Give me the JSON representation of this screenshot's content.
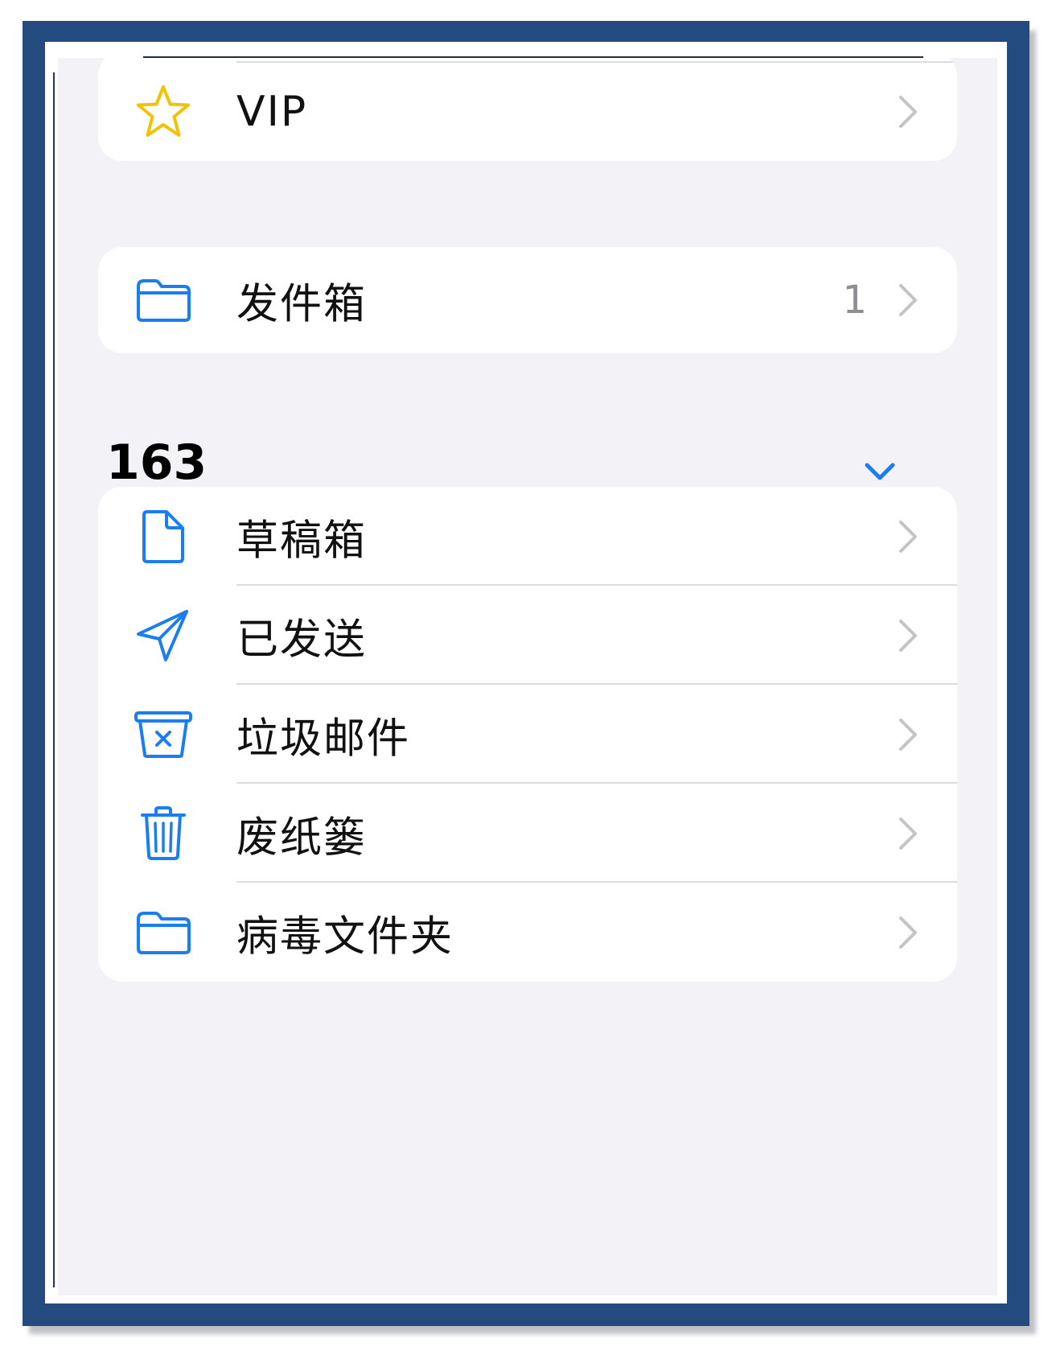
{
  "colors": {
    "accent": "#1a7ef2",
    "vip_star": "#f2c200",
    "chevron": "#c4c4c8",
    "frame": "#234b80",
    "background": "#f2f2f7"
  },
  "top_group": {
    "vip": {
      "label": "VIP",
      "icon": "star-icon"
    }
  },
  "outbox_group": {
    "outbox": {
      "label": "发件箱",
      "count": "1",
      "icon": "folder-icon"
    }
  },
  "account": {
    "name": "163",
    "toggle_icon": "chevron-down-icon",
    "folders": [
      {
        "label": "草稿箱",
        "icon": "document-icon"
      },
      {
        "label": "已发送",
        "icon": "paper-plane-icon"
      },
      {
        "label": "垃圾邮件",
        "icon": "junk-box-icon"
      },
      {
        "label": "废纸篓",
        "icon": "trash-icon"
      },
      {
        "label": "病毒文件夹",
        "icon": "folder-icon"
      }
    ]
  }
}
